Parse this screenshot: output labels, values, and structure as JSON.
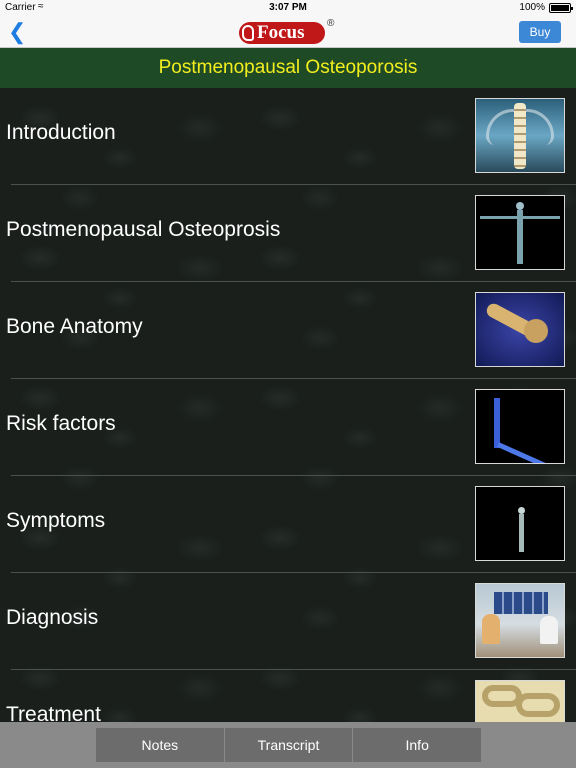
{
  "status_bar": {
    "carrier": "Carrier",
    "wifi_icon": "wifi-icon",
    "time": "3:07 PM",
    "battery": "100%"
  },
  "nav": {
    "back_icon": "chevron-left-icon",
    "logo_text": "Focus",
    "logo_reg": "®",
    "buy_label": "Buy"
  },
  "title": "Postmenopausal Osteoporosis",
  "items": [
    {
      "label": "Introduction",
      "thumbnail": "spine-xray"
    },
    {
      "label": "Postmenopausal Osteoprosis",
      "thumbnail": "skeleton-figure"
    },
    {
      "label": "Bone Anatomy",
      "thumbnail": "femur-bone"
    },
    {
      "label": "Risk factors",
      "thumbnail": "risk-graph"
    },
    {
      "label": "Symptoms",
      "thumbnail": "small-skeleton"
    },
    {
      "label": "Diagnosis",
      "thumbnail": "doctor-consult"
    },
    {
      "label": "Treatment",
      "thumbnail": "bone-structure"
    }
  ],
  "tabs": [
    {
      "label": "Notes"
    },
    {
      "label": "Transcript"
    },
    {
      "label": "Info"
    }
  ],
  "colors": {
    "accent": "#3d88d6",
    "title_bg": "#1f4a26",
    "title_text": "#f2ee1e"
  }
}
